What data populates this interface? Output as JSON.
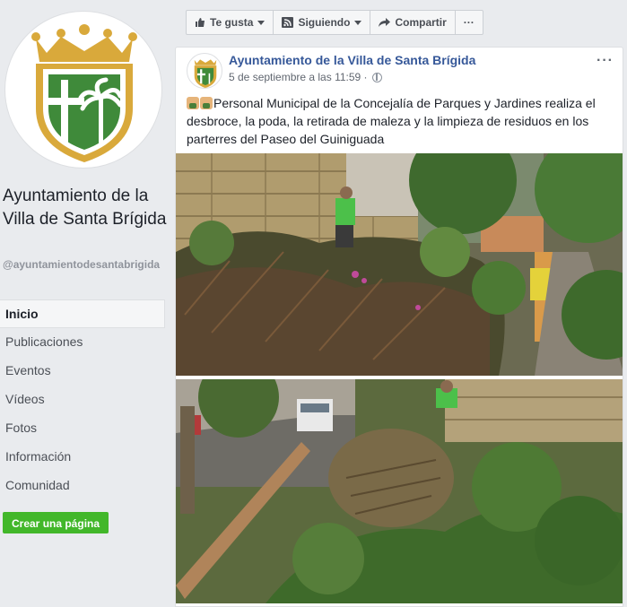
{
  "sidebar": {
    "page_name": "Ayuntamiento de la Villa de Santa Brígida",
    "handle": "@ayuntamientodesantabrigida",
    "nav": [
      {
        "label": "Inicio",
        "active": true
      },
      {
        "label": "Publicaciones"
      },
      {
        "label": "Eventos"
      },
      {
        "label": "Vídeos"
      },
      {
        "label": "Fotos"
      },
      {
        "label": "Información"
      },
      {
        "label": "Comunidad"
      }
    ],
    "create_page": "Crear una página"
  },
  "toolbar": {
    "like": "Te gusta",
    "following": "Siguiendo",
    "share": "Compartir",
    "more": "···"
  },
  "post": {
    "author": "Ayuntamiento de la Villa de Santa Brígida",
    "date": "5 de septiembre a las 11:59 ·",
    "text": "Personal Municipal de la Concejalía de Parques y Jardines realiza el desbroce, la poda, la retirada de maleza y la limpieza de residuos en los parterres del Paseo del Guiniguada",
    "more": "···"
  },
  "colors": {
    "link": "#365899",
    "green_button": "#42b72a",
    "crest_green": "#3f8a3a",
    "crest_gold": "#d9a93b"
  }
}
